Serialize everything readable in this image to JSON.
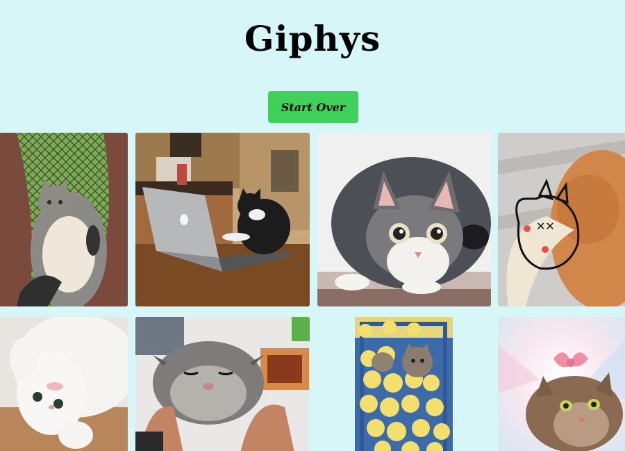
{
  "header": {
    "title": "Giphys"
  },
  "controls": {
    "start_over_label": "Start Over"
  },
  "gallery": {
    "items": [
      {
        "name": "gif-cat-hammock",
        "icon": "cat-in-hammock"
      },
      {
        "name": "gif-cat-laptop",
        "icon": "cat-typing-on-laptop"
      },
      {
        "name": "gif-cat-crouching",
        "icon": "cat-crouching"
      },
      {
        "name": "gif-cat-cartoon-drawing",
        "icon": "cat-with-cartoon-drawing"
      },
      {
        "name": "gif-white-kitten",
        "icon": "white-kitten-rolling"
      },
      {
        "name": "gif-cat-face-squish",
        "icon": "cat-face-squished"
      },
      {
        "name": "gif-cat-with-chicks",
        "icon": "cat-in-basket-with-chicks"
      },
      {
        "name": "gif-cat-with-bow",
        "icon": "cat-with-pink-bow"
      }
    ]
  }
}
